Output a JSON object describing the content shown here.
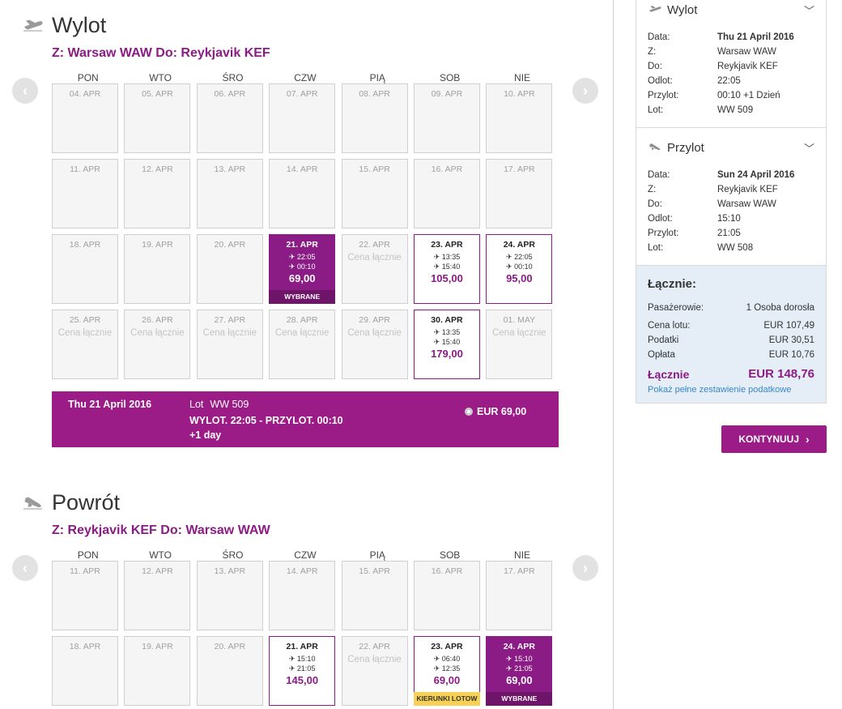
{
  "outbound": {
    "title": "Wylot",
    "route": "Z: Warsaw WAW Do: Reykjavik KEF",
    "days": [
      "PON",
      "WTO",
      "ŚRO",
      "CZW",
      "PIĄ",
      "SOB",
      "NIE"
    ],
    "weeks": [
      [
        {
          "date": "04. APR",
          "state": "empty"
        },
        {
          "date": "05. APR",
          "state": "empty"
        },
        {
          "date": "06. APR",
          "state": "empty"
        },
        {
          "date": "07. APR",
          "state": "empty"
        },
        {
          "date": "08. APR",
          "state": "empty"
        },
        {
          "date": "09. APR",
          "state": "empty"
        },
        {
          "date": "10. APR",
          "state": "empty"
        }
      ],
      [
        {
          "date": "11. APR",
          "state": "empty"
        },
        {
          "date": "12. APR",
          "state": "empty"
        },
        {
          "date": "13. APR",
          "state": "empty"
        },
        {
          "date": "14. APR",
          "state": "empty"
        },
        {
          "date": "15. APR",
          "state": "empty"
        },
        {
          "date": "16. APR",
          "state": "empty"
        },
        {
          "date": "17. APR",
          "state": "empty"
        }
      ],
      [
        {
          "date": "18. APR",
          "state": "empty"
        },
        {
          "date": "19. APR",
          "state": "empty"
        },
        {
          "date": "20. APR",
          "state": "empty"
        },
        {
          "date": "21. APR",
          "state": "selected",
          "dep": "22:05",
          "arr": "00:10",
          "price": "69,00",
          "tag": "WYBRANE"
        },
        {
          "date": "22. APR",
          "state": "na",
          "text": "Cena łącznie"
        },
        {
          "date": "23. APR",
          "state": "avail",
          "dep": "13:35",
          "arr": "15:40",
          "price": "105,00"
        },
        {
          "date": "24. APR",
          "state": "avail",
          "dep": "22:05",
          "arr": "00:10",
          "price": "95,00"
        }
      ],
      [
        {
          "date": "25. APR",
          "state": "na",
          "text": "Cena łącznie"
        },
        {
          "date": "26. APR",
          "state": "na",
          "text": "Cena łącznie"
        },
        {
          "date": "27. APR",
          "state": "na",
          "text": "Cena łącznie"
        },
        {
          "date": "28. APR",
          "state": "na",
          "text": "Cena łącznie"
        },
        {
          "date": "29. APR",
          "state": "na",
          "text": "Cena łącznie"
        },
        {
          "date": "30. APR",
          "state": "avail",
          "dep": "13:35",
          "arr": "15:40",
          "price": "179,00"
        },
        {
          "date": "01. MAY",
          "state": "na",
          "text": "Cena łącznie"
        }
      ]
    ],
    "summary": {
      "date": "Thu 21 April 2016",
      "lot_label": "Lot",
      "lot": "WW 509",
      "times": "WYLOT. 22:05 - PRZYLOT. 00:10",
      "extra": "+1 day",
      "price": "EUR 69,00"
    }
  },
  "inbound": {
    "title": "Powrót",
    "route": "Z: Reykjavik KEF Do: Warsaw WAW",
    "days": [
      "PON",
      "WTO",
      "ŚRO",
      "CZW",
      "PIĄ",
      "SOB",
      "NIE"
    ],
    "weeks": [
      [
        {
          "date": "11. APR",
          "state": "empty"
        },
        {
          "date": "12. APR",
          "state": "empty"
        },
        {
          "date": "13. APR",
          "state": "empty"
        },
        {
          "date": "14. APR",
          "state": "empty"
        },
        {
          "date": "15. APR",
          "state": "empty"
        },
        {
          "date": "16. APR",
          "state": "empty"
        },
        {
          "date": "17. APR",
          "state": "empty"
        }
      ],
      [
        {
          "date": "18. APR",
          "state": "empty"
        },
        {
          "date": "19. APR",
          "state": "empty"
        },
        {
          "date": "20. APR",
          "state": "empty"
        },
        {
          "date": "21. APR",
          "state": "avail",
          "dep": "15:10",
          "arr": "21:05",
          "price": "145,00"
        },
        {
          "date": "22. APR",
          "state": "na",
          "text": "Cena łącznie"
        },
        {
          "date": "23. APR",
          "state": "avail",
          "dep": "06:40",
          "arr": "12:35",
          "price": "69,00",
          "tag": "KIERUNKI LOTOW",
          "tagType": "kier"
        },
        {
          "date": "24. APR",
          "state": "selected",
          "dep": "15:10",
          "arr": "21:05",
          "price": "69,00",
          "tag": "WYBRANE"
        }
      ]
    ]
  },
  "sidebar": {
    "outbound": {
      "title": "Wylot",
      "rows": [
        {
          "k": "Data:",
          "v": "Thu 21 April 2016"
        },
        {
          "k": "Z:",
          "v": "Warsaw WAW"
        },
        {
          "k": "Do:",
          "v": "Reykjavik KEF"
        },
        {
          "k": "Odlot:",
          "v": "22:05"
        },
        {
          "k": "Przylot:",
          "v": "00:10 +1 Dzień"
        },
        {
          "k": "Lot:",
          "v": "WW 509"
        }
      ]
    },
    "inbound": {
      "title": "Przylot",
      "rows": [
        {
          "k": "Data:",
          "v": "Sun 24 April 2016"
        },
        {
          "k": "Z:",
          "v": "Reykjavik KEF"
        },
        {
          "k": "Do:",
          "v": "Warsaw WAW"
        },
        {
          "k": "Odlot:",
          "v": "15:10"
        },
        {
          "k": "Przylot:",
          "v": "21:05"
        },
        {
          "k": "Lot:",
          "v": "WW 508"
        }
      ]
    },
    "totals": {
      "title": "Łącznie:",
      "passengers_label": "Pasażerowie:",
      "passengers": "1 Osoba dorosła",
      "fare_label": "Cena lotu:",
      "fare": "EUR 107,49",
      "tax_label": "Podatki",
      "tax": "EUR 30,51",
      "fee_label": "Opłata",
      "fee": "EUR 10,76",
      "total_label": "Łącznie",
      "total": "EUR 148,76",
      "link": "Pokaż pełne zestawienie podatkowe"
    }
  },
  "continue_label": "KONTYNUUJ",
  "colors": {
    "brand": "#9b1b87",
    "highlight": "#f7d154",
    "panel": "#e5eef7"
  }
}
